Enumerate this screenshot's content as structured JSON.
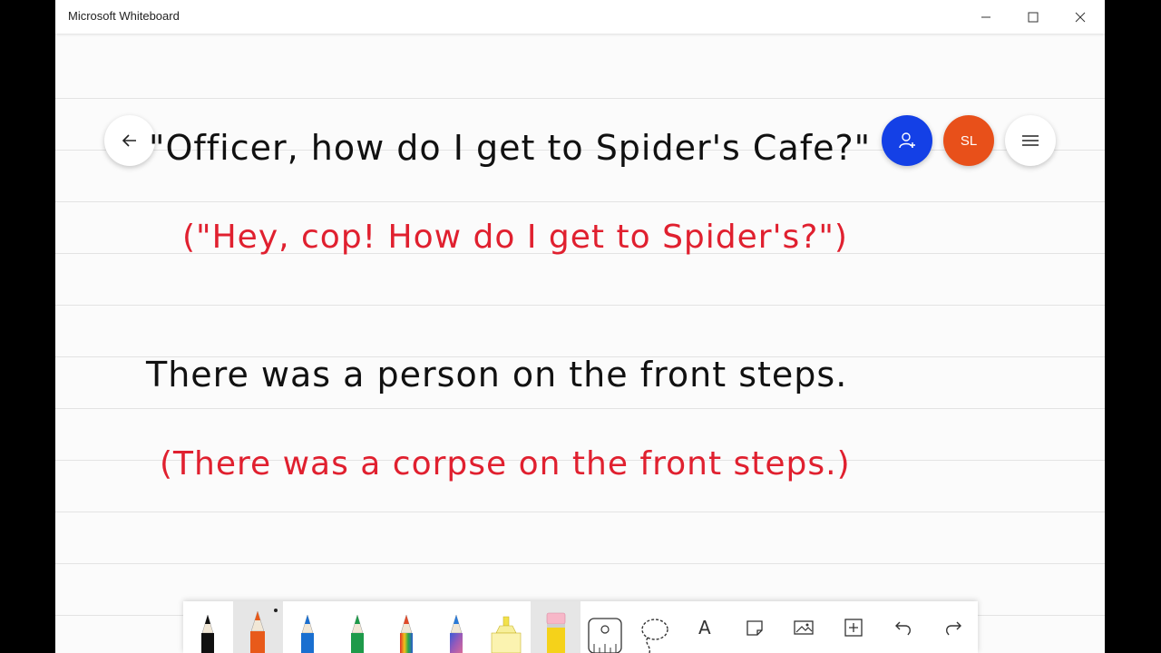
{
  "window": {
    "title": "Microsoft Whiteboard",
    "controls": {
      "minimize": "minimize",
      "maximize": "maximize",
      "close": "close"
    }
  },
  "header": {
    "avatar_initials": "SL",
    "colors": {
      "invite": "#1440e6",
      "avatar": "#e8501a"
    }
  },
  "board": {
    "lines": [
      {
        "text": "\"Officer, how do I get to Spider's Cafe?\"",
        "color": "#111111"
      },
      {
        "text": "(\"Hey, cop! How do I get to Spider's?\")",
        "color": "#e0202f"
      },
      {
        "text": "There was a person on the front steps.",
        "color": "#111111"
      },
      {
        "text": "(There was a corpse on the front steps.)",
        "color": "#e0202f"
      }
    ]
  },
  "toolbar": {
    "tools": [
      {
        "name": "black-pen",
        "color": "#111111"
      },
      {
        "name": "orange-pen",
        "color": "#e85a1a",
        "selected": true
      },
      {
        "name": "blue-pen",
        "color": "#1a6fd0"
      },
      {
        "name": "green-pen",
        "color": "#1e9a4a"
      },
      {
        "name": "rainbow-pen",
        "color": "#e04a2a"
      },
      {
        "name": "galaxy-pen",
        "color": "#7a5ab0"
      },
      {
        "name": "yellow-highlighter",
        "color": "#f2e14a"
      },
      {
        "name": "eraser",
        "color": "#f7b7c8",
        "selected": true
      },
      {
        "name": "ruler-icon"
      },
      {
        "name": "lasso-icon"
      },
      {
        "name": "text-icon",
        "label": "A"
      },
      {
        "name": "note-icon"
      },
      {
        "name": "image-icon"
      },
      {
        "name": "insert-icon"
      },
      {
        "name": "undo-icon"
      },
      {
        "name": "redo-icon"
      }
    ]
  }
}
